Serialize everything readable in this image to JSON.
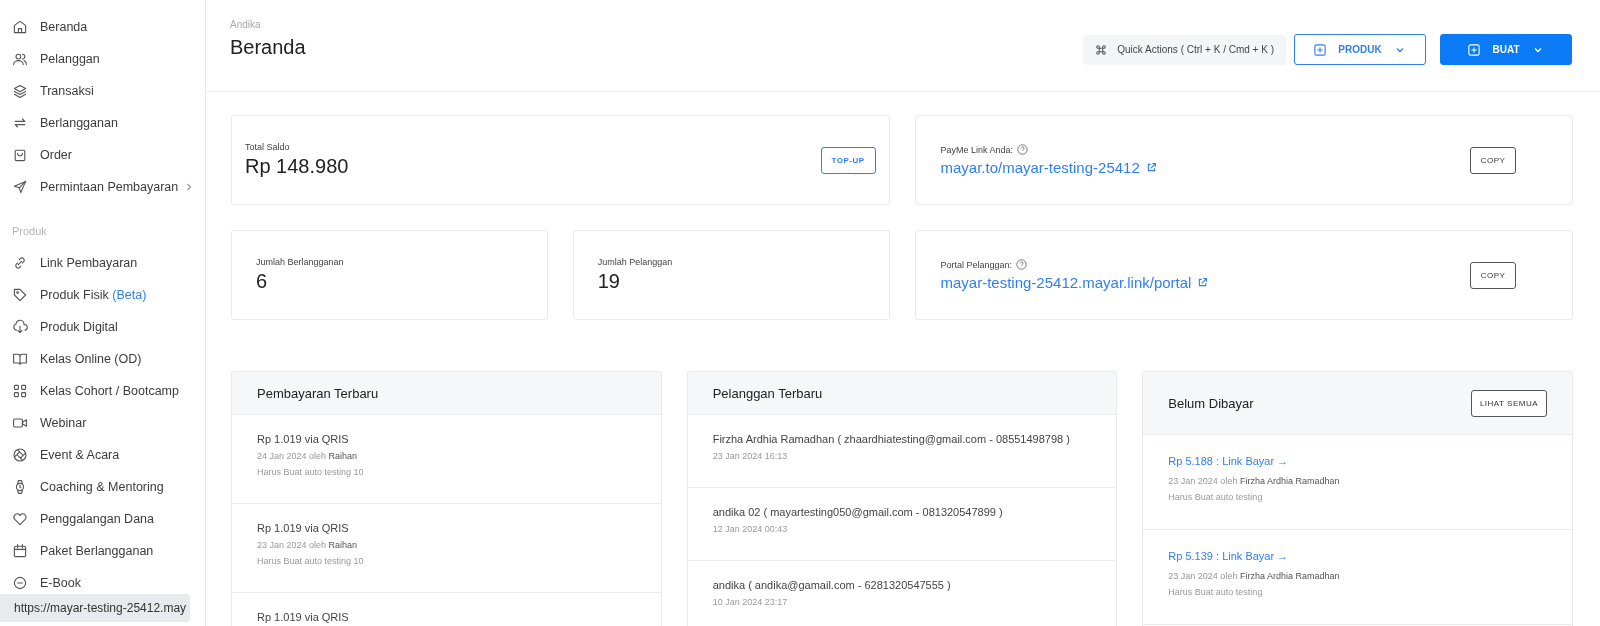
{
  "sidebar": {
    "items": [
      {
        "label": "Beranda",
        "selected": false,
        "expandable": false
      },
      {
        "label": "Pelanggan",
        "selected": false,
        "expandable": false
      },
      {
        "label": "Transaksi",
        "selected": false,
        "expandable": false
      },
      {
        "label": "Berlangganan",
        "selected": false,
        "expandable": false
      },
      {
        "label": "Order",
        "selected": false,
        "expandable": false
      },
      {
        "label": "Permintaan Pembayaran",
        "selected": false,
        "expandable": true
      }
    ],
    "section_label": "Produk",
    "product_items": [
      {
        "label": "Link Pembayaran",
        "selected": false
      },
      {
        "label": "Produk Fisik",
        "badge": "(Beta)",
        "selected": false
      },
      {
        "label": "Produk Digital",
        "selected": false
      },
      {
        "label": "Kelas Online (OD)",
        "selected": false
      },
      {
        "label": "Kelas Cohort / Bootcamp",
        "selected": false
      },
      {
        "label": "Webinar",
        "selected": false
      },
      {
        "label": "Event & Acara",
        "selected": false
      },
      {
        "label": "Coaching & Mentoring",
        "selected": false
      },
      {
        "label": "Penggalangan Dana",
        "selected": false
      },
      {
        "label": "Paket Berlangganan",
        "selected": false
      },
      {
        "label": "E-Book",
        "selected": false
      }
    ],
    "status_url": "https://mayar-testing-25412.may"
  },
  "header": {
    "breadcrumb": "Andika",
    "title": "Beranda",
    "quick_actions": "Quick Actions ( Ctrl + K / Cmd + K )",
    "buttons": [
      {
        "label": "PRODUK",
        "kind": "outline"
      },
      {
        "label": "BUAT",
        "kind": "primary"
      }
    ]
  },
  "balance": {
    "label": "Total Saldo",
    "value": "Rp 148.980",
    "button": "TOP-UP"
  },
  "stats": [
    {
      "label": "Jumlah Berlangganan",
      "value": "6"
    },
    {
      "label": "Jumlah Pelanggan",
      "value": "19"
    }
  ],
  "links": [
    {
      "label": "PayMe Link Anda:",
      "url": "mayar.to/mayar-testing-25412",
      "button": "COPY"
    },
    {
      "label": "Portal Pelanggan:",
      "url": "mayar-testing-25412.mayar.link/portal",
      "button": "COPY"
    }
  ],
  "payments": {
    "title": "Pembayaran Terbaru",
    "items": [
      {
        "title": "Rp 1.019 via QRIS",
        "meta": "24 Jan 2024 oleh",
        "by": "Raihan",
        "note": "Harus Buat auto testing 10"
      },
      {
        "title": "Rp 1.019 via QRIS",
        "meta": "23 Jan 2024 oleh",
        "by": "Raihan",
        "note": "Harus Buat auto testing 10"
      },
      {
        "title": "Rp 1.019 via QRIS"
      }
    ]
  },
  "customers": {
    "title": "Pelanggan Terbaru",
    "items": [
      {
        "name": "Firzha Ardhia Ramadhan ( zhaardhiatesting@gmail.com - 08551498798 )",
        "time": "23 Jan 2024 16:13"
      },
      {
        "name": "andika 02 ( mayartesting050@gmail.com - 081320547899 )",
        "time": "12 Jan 2024 00:43"
      },
      {
        "name": "andika ( andika@gamail.com - 6281320547555 )",
        "time": "10 Jan 2024 23:17"
      }
    ]
  },
  "unpaid": {
    "title": "Belum Dibayar",
    "button": "LIHAT SEMUA",
    "items": [
      {
        "link": "Rp 5.188 : Link Bayar →",
        "meta": "23 Jan 2024 oleh",
        "by": "Firzha Ardhia Ramadhan",
        "note": "Harus Buat auto testing"
      },
      {
        "link": "Rp 5.139 : Link Bayar →",
        "meta": "23 Jan 2024 oleh",
        "by": "Firzha Ardhia Ramadhan",
        "note": "Harus Buat auto testing"
      }
    ]
  }
}
